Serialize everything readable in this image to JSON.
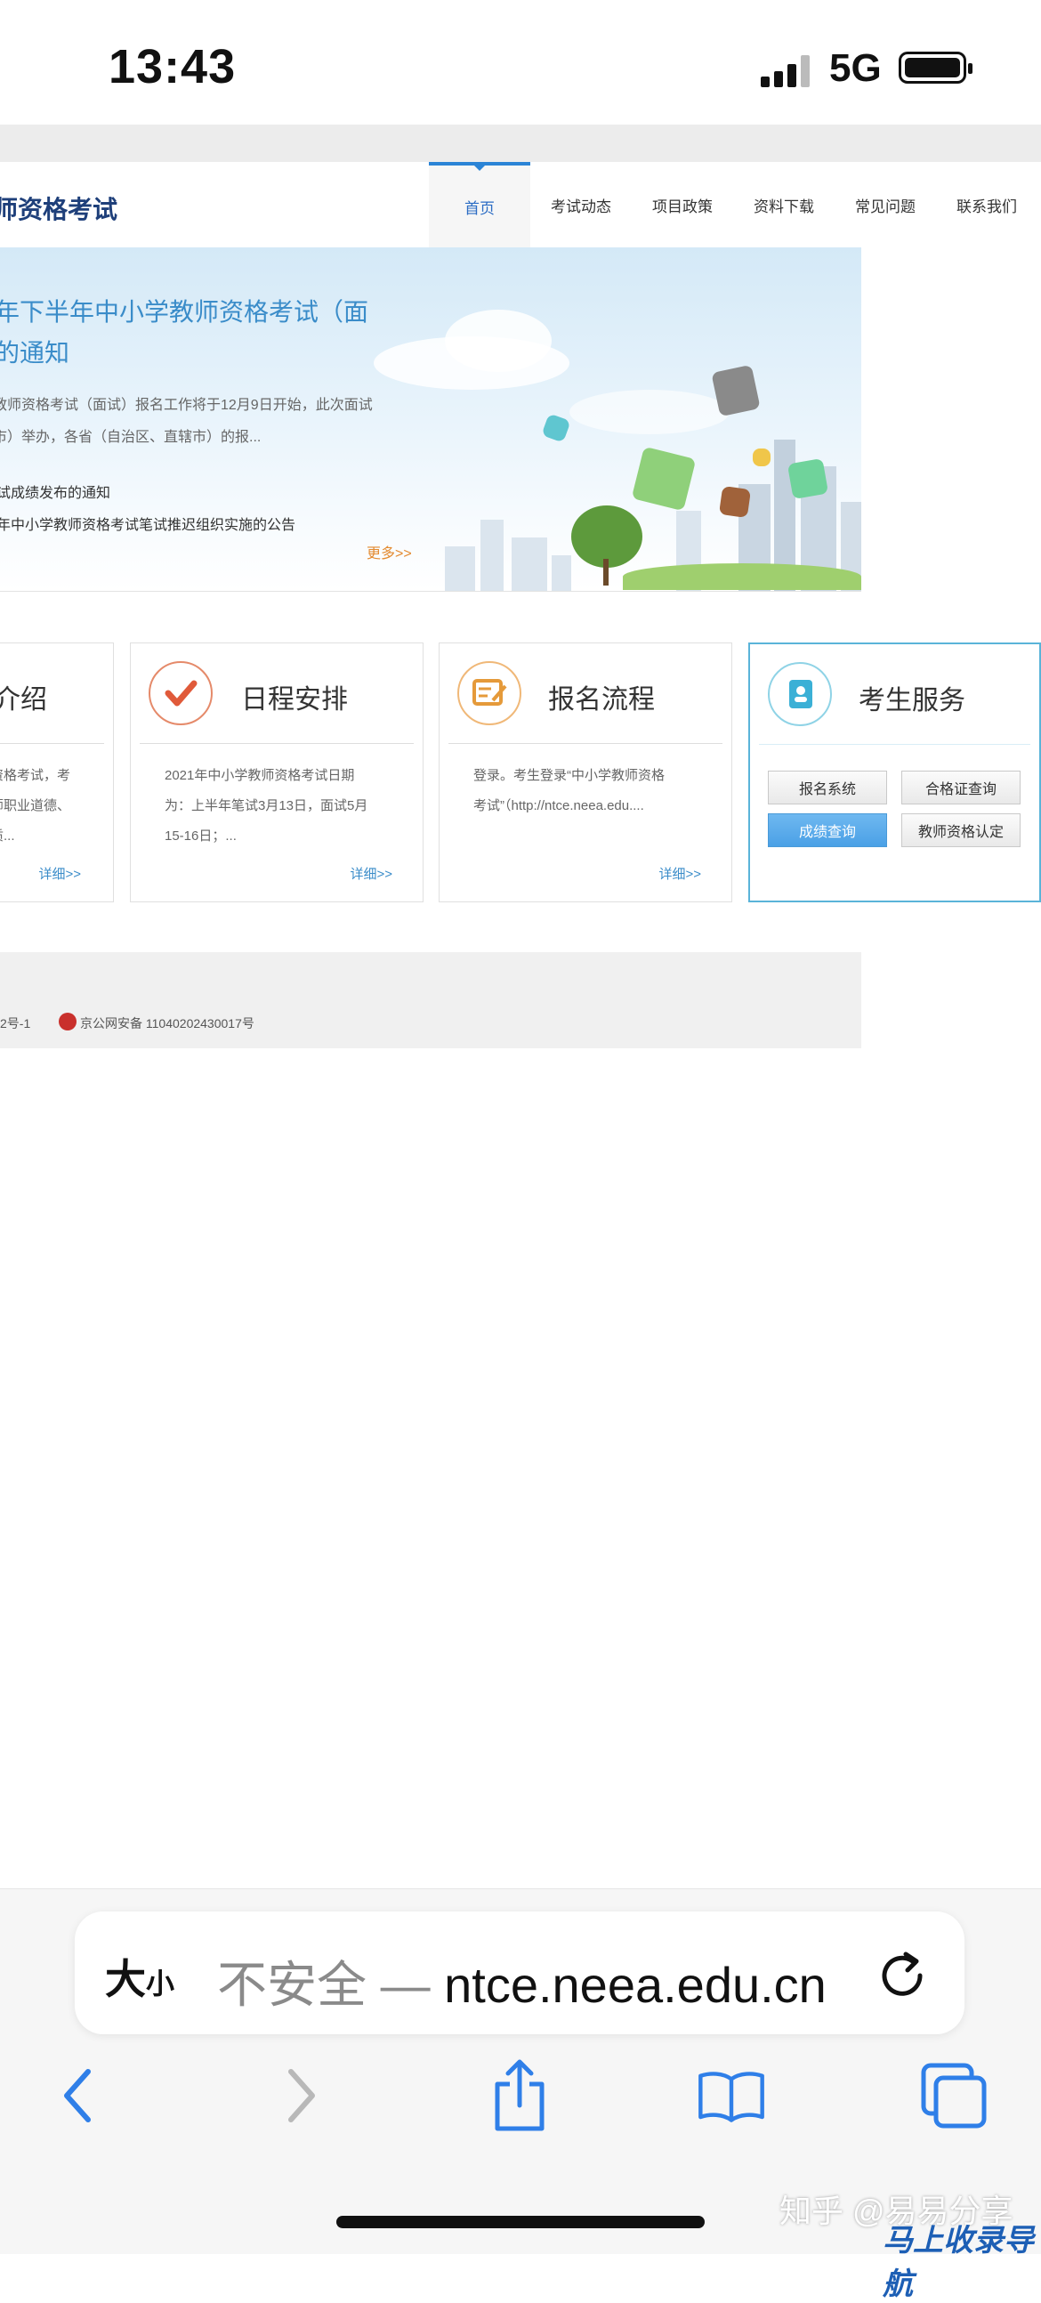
{
  "status_bar": {
    "time": "13:43",
    "network": "5G"
  },
  "site": {
    "title": "师资格考试",
    "nav": [
      {
        "label": "首页",
        "active": true
      },
      {
        "label": "考试动态"
      },
      {
        "label": "项目政策"
      },
      {
        "label": "资料下载"
      },
      {
        "label": "常见问题"
      },
      {
        "label": "联系我们"
      }
    ]
  },
  "banner": {
    "headline_line1": "年下半年中小学教师资格考试（面",
    "headline_line2": "的通知",
    "desc_line1": "教师资格考试（面试）报名工作将于12月9日开始，此次面试",
    "desc_line2": "市）举办，各省（自治区、直辖市）的报...",
    "link1": "试成绩发布的通知",
    "link2": "年中小学教师资格考试笔试推迟组织实施的公告",
    "more": "更多>>"
  },
  "cards": {
    "intro": {
      "title": "介绍",
      "line1": "资格考试，考",
      "line2": "师职业道德、",
      "line3": "质...",
      "more": "详细>>"
    },
    "schedule": {
      "title": "日程安排",
      "line1": "2021年中小学教师资格考试日期",
      "line2": "为：上半年笔试3月13日，面试5月",
      "line3": "15-16日；...",
      "more": "详细>>"
    },
    "process": {
      "title": "报名流程",
      "line1": "登录。考生登录“中小学教师资格",
      "line2": "考试”（http://ntce.neea.edu....",
      "more": "详细>>"
    },
    "service": {
      "title": "考生服务",
      "buttons": [
        "报名系统",
        "合格证查询",
        "成绩查询",
        "教师资格认定"
      ]
    }
  },
  "footer": {
    "left": "2号-1",
    "police": "京公网安备 11040202430017号"
  },
  "safari": {
    "text_size": "大",
    "text_size_small": "小",
    "insecure_label": "不安全",
    "dash": "—",
    "domain": "ntce.neea.edu.cn"
  },
  "watermark": {
    "line1": "知乎 @易易分享",
    "line2": "马上收录导航"
  },
  "colors": {
    "accent": "#2b84d6",
    "link": "#3a8cc9",
    "primary_button": "#4aa0e6",
    "more": "#e38a2f"
  }
}
